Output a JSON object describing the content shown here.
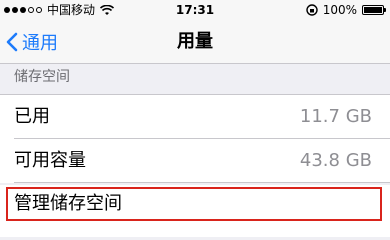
{
  "status_bar": {
    "carrier": "中国移动",
    "time": "17:31",
    "battery": "100%",
    "battery_level": 1.0,
    "icons": [
      "signal-icon",
      "wifi-icon",
      "rotation-lock-icon",
      "battery-icon"
    ]
  },
  "nav": {
    "back_label": "通用",
    "title": "用量"
  },
  "storage": {
    "section_title": "储存空间",
    "rows": [
      {
        "label": "已用",
        "value": "11.7 GB"
      },
      {
        "label": "可用容量",
        "value": "43.8 GB"
      }
    ],
    "manage_label": "管理储存空间"
  },
  "colors": {
    "accent": "#1d7bfb",
    "highlight": "#d9241c",
    "background": "#efeff4"
  }
}
